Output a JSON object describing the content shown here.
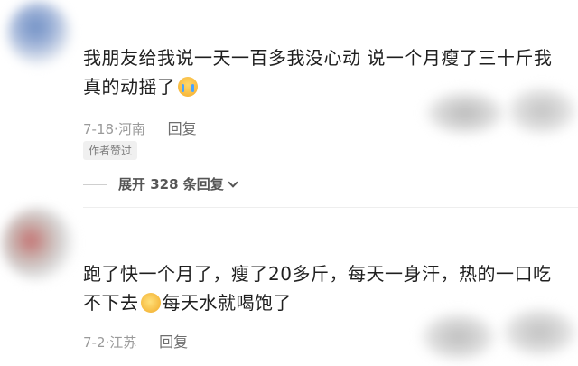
{
  "comments": [
    {
      "text_part1": "我朋友给我说一天一百多我没心动 说一个月瘦了三十斤我真的动摇了",
      "emoji": "crying-face",
      "date": "7-18",
      "location": "河南",
      "reply_label": "回复",
      "badge": "作者赞过",
      "expand_label": "展开 328 条回复"
    },
    {
      "text_part1": "跑了快一个月了，瘦了20多斤，每天一身汗，热的一口吃不下去",
      "emoji": "sweating-face",
      "text_part2": "每天水就喝饱了",
      "date": "7-2",
      "location": "江苏",
      "reply_label": "回复"
    }
  ],
  "separator": "·"
}
